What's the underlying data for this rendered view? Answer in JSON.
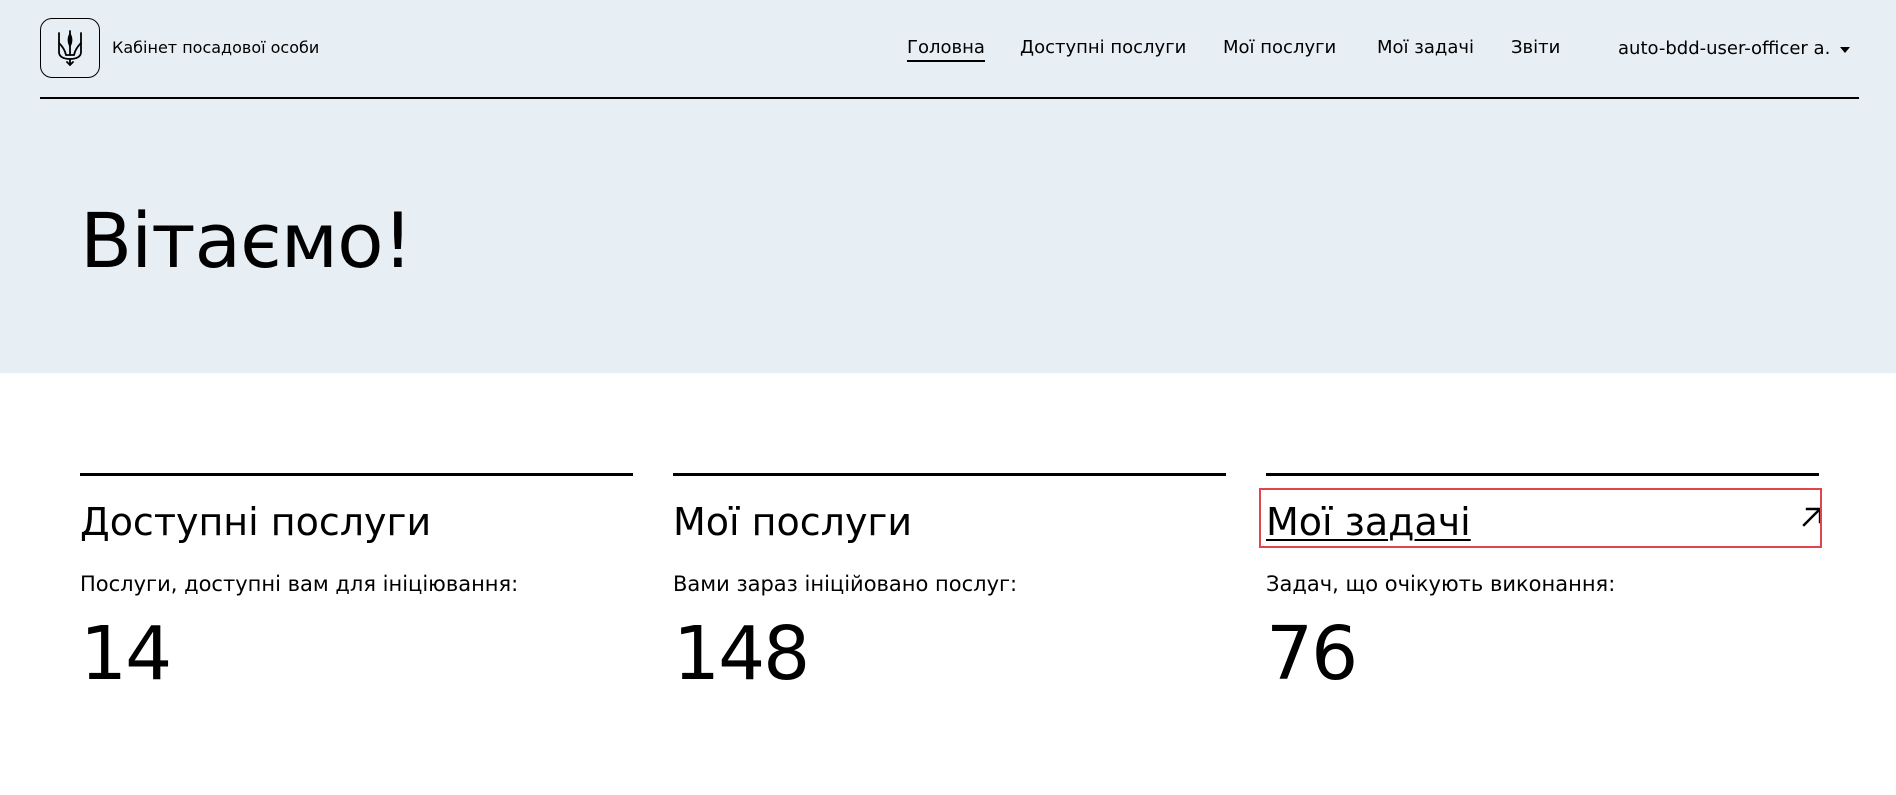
{
  "header": {
    "brand_title": "Кабінет посадової особи",
    "logo_icon": "trident-icon",
    "nav": [
      {
        "label": "Головна",
        "active": true
      },
      {
        "label": "Доступні послуги",
        "active": false
      },
      {
        "label": "Мої послуги",
        "active": false
      },
      {
        "label": "Мої задачі",
        "active": false
      },
      {
        "label": "Звіти",
        "active": false
      }
    ],
    "user": {
      "name": "auto-bdd-user-officer a.",
      "caret_icon": "caret-down-icon"
    }
  },
  "hero": {
    "title": "Вітаємо!"
  },
  "cards": [
    {
      "title": "Доступні послуги",
      "description": "Послуги, доступні вам для ініціювання:",
      "value": "14"
    },
    {
      "title": "Мої послуги",
      "description": "Вами зараз ініційовано послуг:",
      "value": "148"
    },
    {
      "title": "Мої задачі",
      "description": "Задач, що очікують виконання:",
      "value": "76",
      "link_icon": "arrow-up-right-icon"
    }
  ],
  "colors": {
    "hero_background": "#e7eef4",
    "page_background": "#ffffff",
    "text": "#000000",
    "highlight_border": "#e0454b"
  }
}
